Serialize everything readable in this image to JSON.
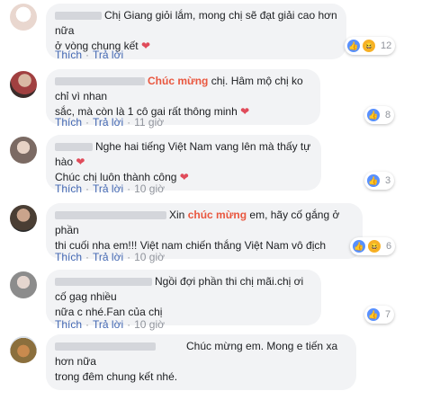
{
  "actions": {
    "like": "Thích",
    "reply": "Trả lời",
    "sep": "·"
  },
  "comments": [
    {
      "text1": "Chị Giang giỏi lắm, mong chị sẽ đạt giải cao hơn nữa",
      "text2": "ở vòng chung kết",
      "time": "",
      "reaction_count": "12",
      "reactions": [
        "like",
        "haha"
      ]
    },
    {
      "text1a": "",
      "highlight": "Chúc mừng",
      "text1b": " chị. Hâm mộ chị ko chỉ vì nhan",
      "text2": "sắc, mà còn là 1 cô gai rất thông minh",
      "time": "11 giờ",
      "reaction_count": "8",
      "reactions": [
        "like"
      ]
    },
    {
      "text1": "Nghe hai tiếng Việt Nam vang lên mà thấy tự hào",
      "text2": "Chúc chị luôn thành công",
      "time": "10 giờ",
      "reaction_count": "3",
      "reactions": [
        "like"
      ]
    },
    {
      "text1a": "Xin ",
      "highlight": "chúc mừng",
      "text1b": " em, hãy cố gắng ở phần",
      "text2": "thi cuối nha em!!! Việt nam chiến thắng Việt Nam vô địch",
      "time": "10 giờ",
      "reaction_count": "6",
      "reactions": [
        "like",
        "haha"
      ]
    },
    {
      "text1": "Ngồi đợi phần thi chị mãi.chị ơi cố gag nhiều",
      "text2": "nữa c nhé.Fan của chị",
      "time": "10 giờ",
      "reaction_count": "7",
      "reactions": [
        "like"
      ]
    },
    {
      "text1": "Chúc mừng em. Mong e tiến xa hơn nữa",
      "text2": "trong đêm chung kết nhé.",
      "time": "",
      "reaction_count": "",
      "reactions": []
    }
  ]
}
